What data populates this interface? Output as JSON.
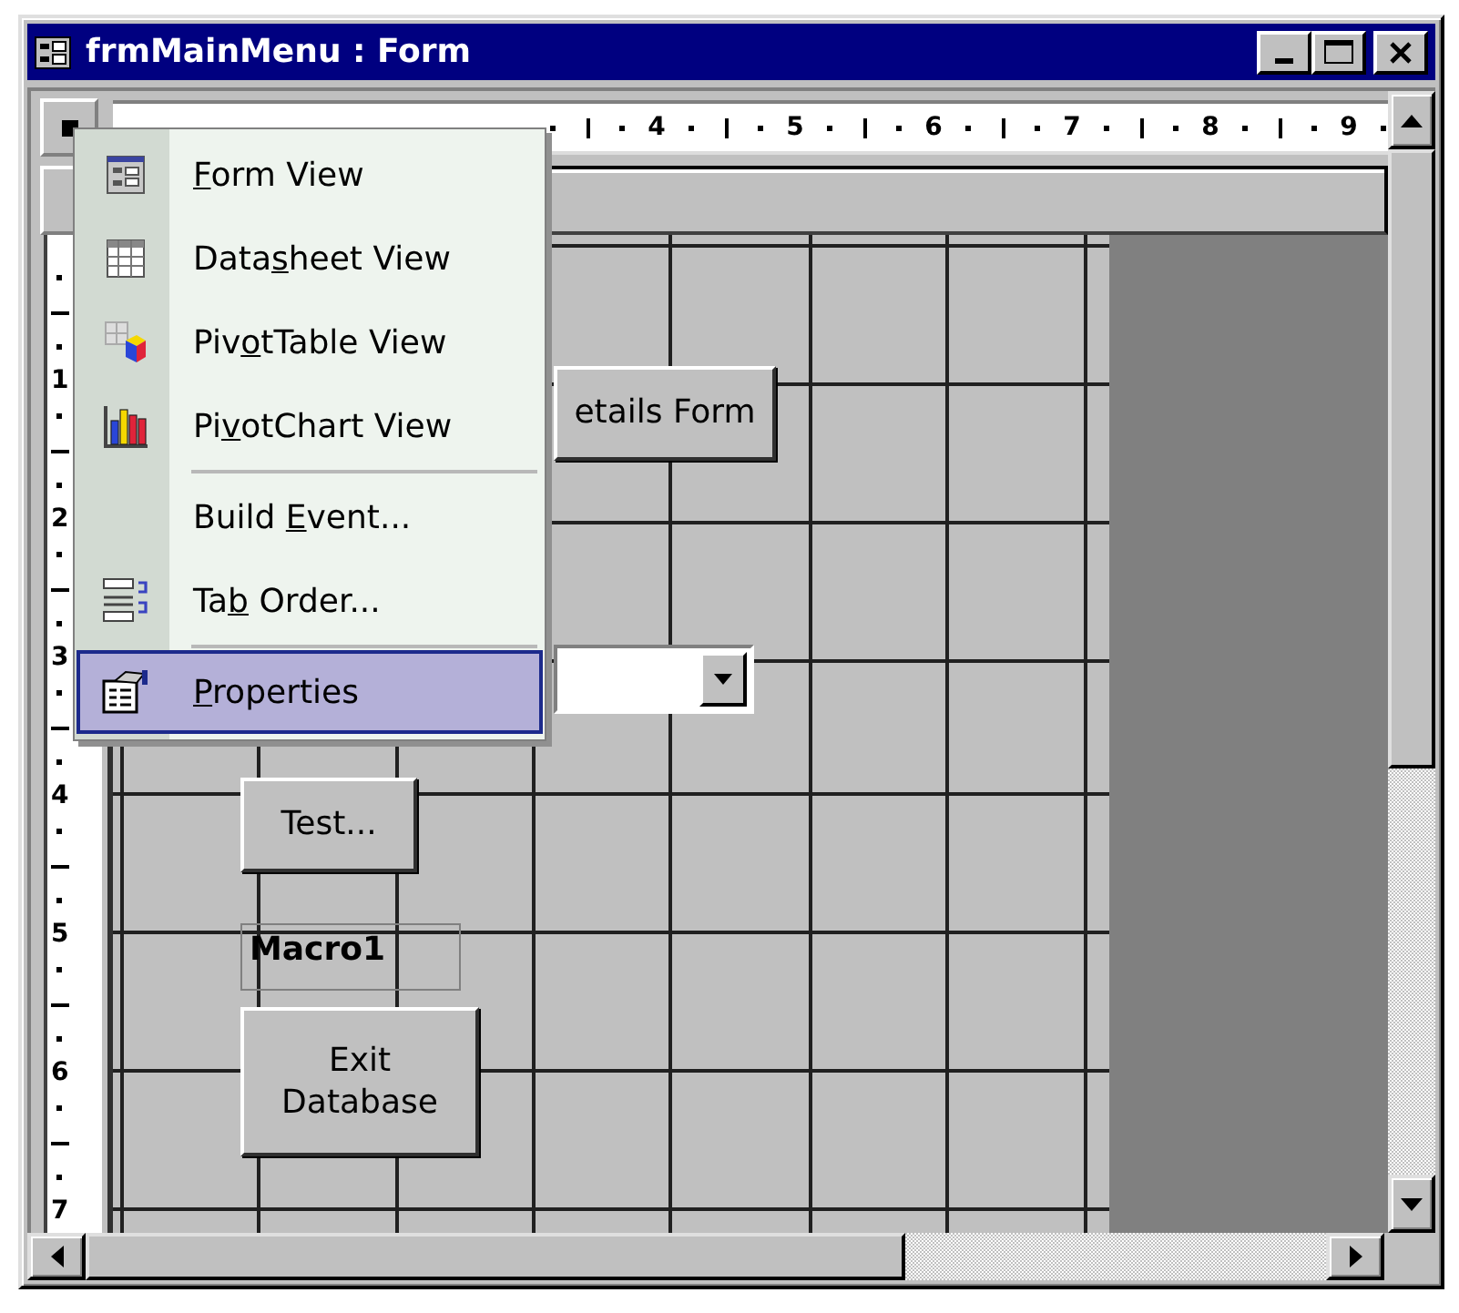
{
  "window": {
    "title": "frmMainMenu : Form"
  },
  "ruler": {
    "horizontal_numbers": [
      "4",
      "5",
      "6",
      "7",
      "8",
      "9"
    ],
    "vertical_numbers": [
      "1",
      "2",
      "3",
      "4",
      "5",
      "6",
      "7"
    ]
  },
  "form": {
    "controls": [
      {
        "kind": "button",
        "label": "etails Form"
      },
      {
        "kind": "combo"
      },
      {
        "kind": "button",
        "label": "Test..."
      },
      {
        "kind": "label",
        "label": "Macro1"
      },
      {
        "kind": "button",
        "label": "Exit Database"
      }
    ]
  },
  "context_menu": {
    "items": [
      {
        "kind": "item",
        "key": "F",
        "after": "orm View",
        "selected": false
      },
      {
        "kind": "item",
        "before": "Data",
        "key": "s",
        "after": "heet View",
        "selected": false
      },
      {
        "kind": "item",
        "before": "Piv",
        "key": "o",
        "after": "tTable View",
        "selected": false
      },
      {
        "kind": "item",
        "before": "Pi",
        "key": "v",
        "after": "otChart View",
        "selected": false
      },
      {
        "kind": "separator"
      },
      {
        "kind": "item",
        "before": "Build ",
        "key": "E",
        "after": "vent...",
        "selected": false
      },
      {
        "kind": "item",
        "before": "Ta",
        "key": "b",
        "after": " Order...",
        "selected": false
      },
      {
        "kind": "separator"
      },
      {
        "kind": "item",
        "key": "P",
        "after": "roperties",
        "selected": true
      }
    ]
  }
}
